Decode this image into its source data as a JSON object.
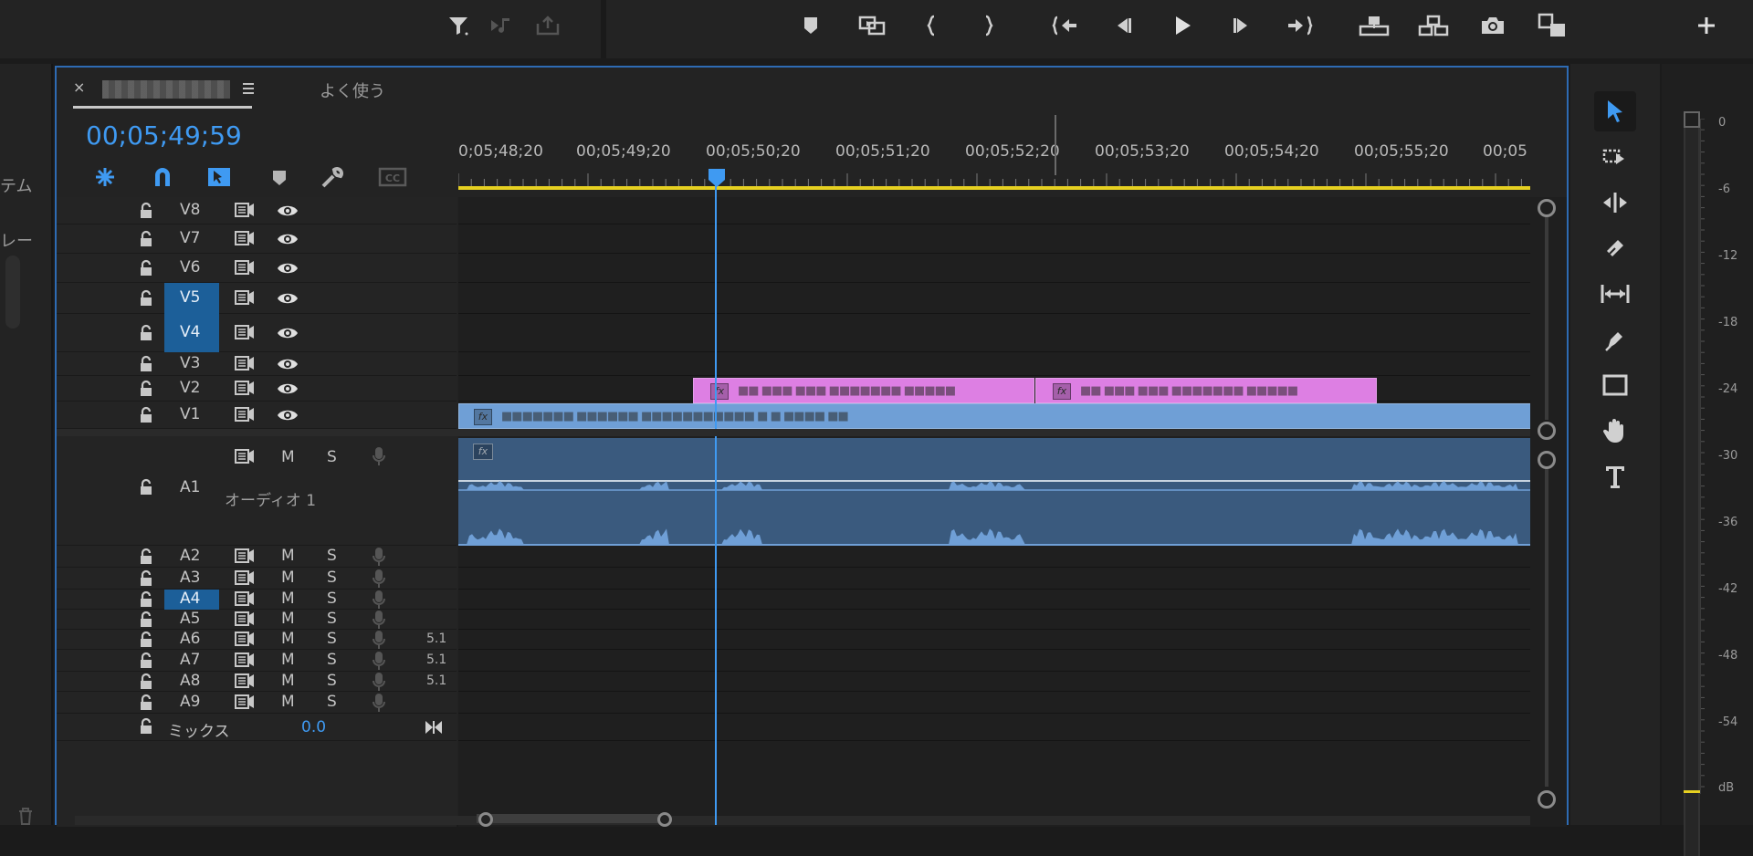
{
  "left_panel": {
    "text1": "テム",
    "text2": "レー"
  },
  "timeline": {
    "tab_title": "■■■■■■■",
    "tab2_label": "よく使う",
    "timecode": "00;05;49;59",
    "ruler_labels": [
      "0;05;48;20",
      "00;05;49;20",
      "00;05;50;20",
      "00;05;51;20",
      "00;05;52;20",
      "00;05;53;20",
      "00;05;54;20",
      "00;05;55;20",
      "00;05"
    ],
    "video_tracks": [
      {
        "name": "V8",
        "highlight": false
      },
      {
        "name": "V7",
        "highlight": false
      },
      {
        "name": "V6",
        "highlight": false
      },
      {
        "name": "V5",
        "highlight": true
      },
      {
        "name": "V4",
        "highlight": true
      },
      {
        "name": "V3",
        "highlight": false
      },
      {
        "name": "V2",
        "highlight": false
      },
      {
        "name": "V1",
        "highlight": false
      }
    ],
    "a1": {
      "name": "A1",
      "track_name": "オーディオ 1",
      "m": "M",
      "s": "S"
    },
    "audio_tracks": [
      {
        "name": "A2",
        "m": "M",
        "s": "S",
        "channel": "",
        "highlight": false
      },
      {
        "name": "A3",
        "m": "M",
        "s": "S",
        "channel": "",
        "highlight": false
      },
      {
        "name": "A4",
        "m": "M",
        "s": "S",
        "channel": "",
        "highlight": true
      },
      {
        "name": "A5",
        "m": "M",
        "s": "S",
        "channel": "",
        "highlight": false
      },
      {
        "name": "A6",
        "m": "M",
        "s": "S",
        "channel": "5.1",
        "highlight": false
      },
      {
        "name": "A7",
        "m": "M",
        "s": "S",
        "channel": "5.1",
        "highlight": false
      },
      {
        "name": "A8",
        "m": "M",
        "s": "S",
        "channel": "5.1",
        "highlight": false
      },
      {
        "name": "A9",
        "m": "M",
        "s": "S",
        "channel": "",
        "highlight": false
      }
    ],
    "mix": {
      "label": "ミックス",
      "value": "0.0"
    },
    "clips": {
      "fx_label": "fx",
      "v2_clip1": "■■ ■■■ ■■■ ■■■■■■■ ■■■■■",
      "v2_clip2": "■■ ■■■ ■■■ ■■■■■■■ ■■■■■",
      "v1_clip": "■■■■■■■ ■■■■■■ ■■■■■■■■■■■ ■ ■ ■■■■ ■■"
    }
  },
  "meter": {
    "labels": [
      "0",
      "-6",
      "-12",
      "-18",
      "-24",
      "-30",
      "-36",
      "-42",
      "-48",
      "-54",
      "dB"
    ]
  },
  "colors": {
    "accent": "#3f9af2",
    "work_area": "#e6d021",
    "v2_clip": "#dd7fe3",
    "v1_clip": "#6f9fd6",
    "audio_clip": "#3a5a7e",
    "selection": "#1c5f99"
  }
}
